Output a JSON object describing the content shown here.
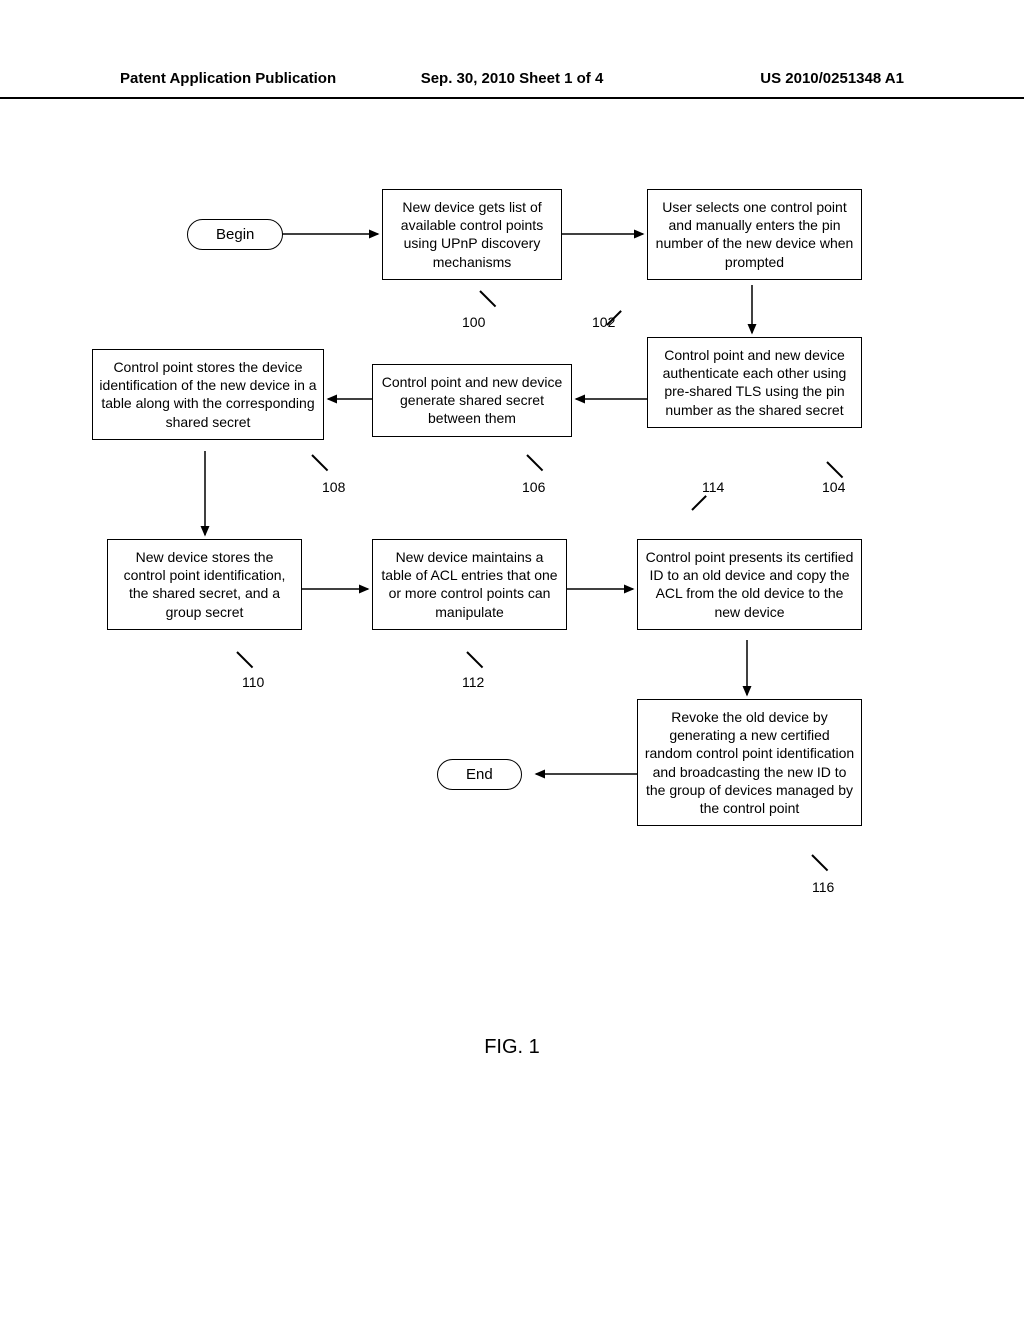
{
  "header": {
    "left": "Patent Application Publication",
    "mid": "Sep. 30, 2010  Sheet 1 of 4",
    "right": "US 2010/0251348 A1"
  },
  "terminals": {
    "begin": "Begin",
    "end": "End"
  },
  "boxes": {
    "b100": "New device gets list of available control points using UPnP discovery mechanisms",
    "b102": "User selects one control point and manually enters the pin number of the new device when prompted",
    "b104": "Control point and new device authenticate each other using pre-shared TLS using the pin number as the shared secret",
    "b106": "Control point and new device generate shared secret between them",
    "b108": "Control point stores the device identification of the new device in a table along with the corresponding shared secret",
    "b110": "New device stores the control point identification, the shared secret, and a group secret",
    "b112": "New device maintains a table of ACL entries that one or more control points can manipulate",
    "b114": "Control point presents its certified ID to an old device and copy the ACL from the old device to the new device",
    "b116": "Revoke the old device by generating a new certified random control point identification and broadcasting the new ID to the group of devices managed by the control point"
  },
  "refs": {
    "r100": "100",
    "r102": "102",
    "r104": "104",
    "r106": "106",
    "r108": "108",
    "r110": "110",
    "r112": "112",
    "r114": "114",
    "r116": "116"
  },
  "figure_label": "FIG. 1"
}
